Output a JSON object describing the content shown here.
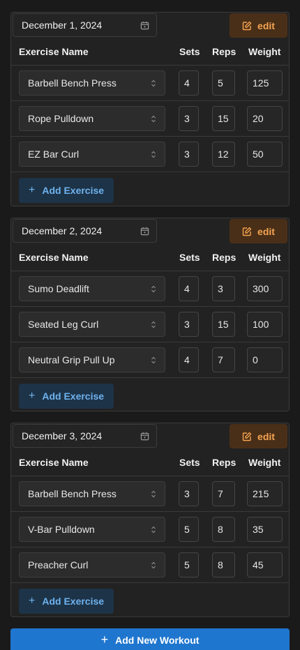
{
  "columns": {
    "name": "Exercise Name",
    "sets": "Sets",
    "reps": "Reps",
    "weight": "Weight"
  },
  "edit_label": "edit",
  "add_exercise_label": "Add Exercise",
  "add_workout_label": "Add New Workout",
  "workouts": [
    {
      "date": "December 1, 2024",
      "exercises": [
        {
          "name": "Barbell Bench Press",
          "sets": "4",
          "reps": "5",
          "weight": "125"
        },
        {
          "name": "Rope Pulldown",
          "sets": "3",
          "reps": "15",
          "weight": "20"
        },
        {
          "name": "EZ Bar Curl",
          "sets": "3",
          "reps": "12",
          "weight": "50"
        }
      ]
    },
    {
      "date": "December 2, 2024",
      "exercises": [
        {
          "name": "Sumo Deadlift",
          "sets": "4",
          "reps": "3",
          "weight": "300"
        },
        {
          "name": "Seated Leg Curl",
          "sets": "3",
          "reps": "15",
          "weight": "100"
        },
        {
          "name": "Neutral Grip Pull Up",
          "sets": "4",
          "reps": "7",
          "weight": "0"
        }
      ]
    },
    {
      "date": "December 3, 2024",
      "exercises": [
        {
          "name": "Barbell Bench Press",
          "sets": "3",
          "reps": "7",
          "weight": "215"
        },
        {
          "name": "V-Bar Pulldown",
          "sets": "5",
          "reps": "8",
          "weight": "35"
        },
        {
          "name": "Preacher Curl",
          "sets": "5",
          "reps": "8",
          "weight": "45"
        }
      ]
    }
  ],
  "colors": {
    "background": "#1a1a1a",
    "card": "#222222",
    "edit_bg": "#4a2f18",
    "edit_text": "#f5a451",
    "add_bg": "#1d3348",
    "add_text": "#6fb3ee",
    "primary": "#1f76cf"
  }
}
